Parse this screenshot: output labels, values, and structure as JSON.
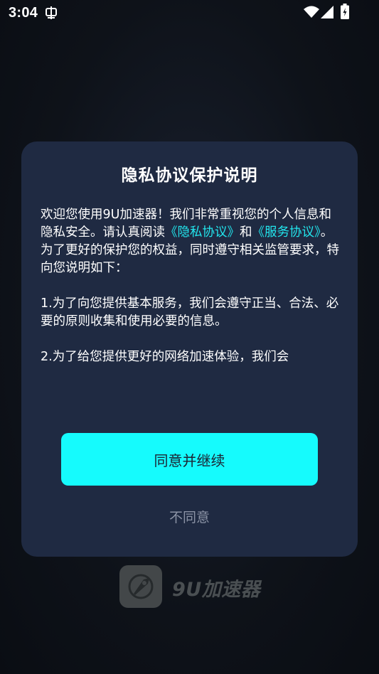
{
  "status_bar": {
    "time": "3:04",
    "icons": [
      "notification-icon",
      "wifi-icon",
      "signal-icon",
      "battery-icon"
    ]
  },
  "dialog": {
    "title": "隐私协议保护说明",
    "intro_part1": "欢迎您使用9U加速器！我们非常重视您的个人信息和隐私安全。请认真阅读",
    "privacy_link": "《隐私协议》",
    "and": "和",
    "service_link": "《服务协议》",
    "intro_part2": "。为了更好的保护您的权益，同时遵守相关监管要求，特向您说明如下：",
    "item1": "1.为了向您提供基本服务，我们会遵守正当、合法、必要的原则收集和使用必要的信息。",
    "item2": "2.为了给您提供更好的网络加速体验，我们会",
    "agree_label": "同意并继续",
    "disagree_label": "不同意"
  },
  "app": {
    "name": "9U加速器"
  },
  "colors": {
    "accent": "#15fbfd",
    "link": "#22e6ee",
    "dialog_bg": "#1f2a42",
    "page_bg": "#0d1119"
  }
}
